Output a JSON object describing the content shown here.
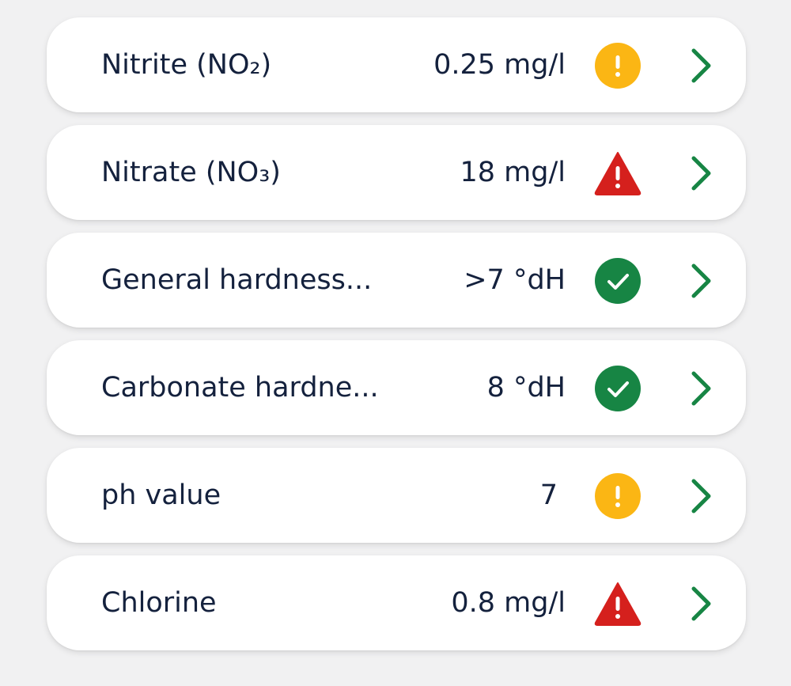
{
  "colors": {
    "text": "#14213d",
    "warning": "#fbb614",
    "danger": "#d5201d",
    "ok": "#178544",
    "chevron": "#178544"
  },
  "rows": [
    {
      "label": "Nitrite (NO₂)",
      "value": "0.25 mg/l",
      "status_icon": "warning-icon",
      "status": "warning"
    },
    {
      "label": "Nitrate (NO₃)",
      "value": "18 mg/l",
      "status_icon": "alert-triangle-icon",
      "status": "danger"
    },
    {
      "label": "General hardness...",
      "value": ">7 °dH",
      "status_icon": "check-circle-icon",
      "status": "ok"
    },
    {
      "label": "Carbonate hardne...",
      "value": "8 °dH",
      "status_icon": "check-circle-icon",
      "status": "ok"
    },
    {
      "label": "ph value",
      "value": "7",
      "status_icon": "warning-icon",
      "status": "warning"
    },
    {
      "label": "Chlorine",
      "value": "0.8 mg/l",
      "status_icon": "alert-triangle-icon",
      "status": "danger"
    }
  ]
}
